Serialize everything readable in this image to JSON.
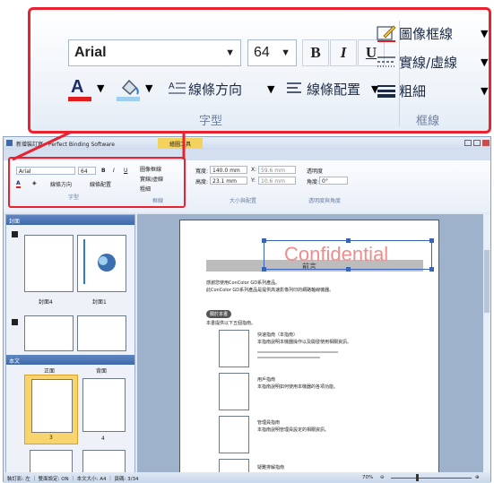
{
  "zoom": {
    "font_name": "Arial",
    "font_size": "64",
    "bold": "B",
    "italic": "I",
    "underline": "U",
    "line_direction": "線條方向",
    "line_layout": "線條配置",
    "group_font": "字型",
    "picture_border": "圖像框線",
    "solid_dashed": "實線/虛線",
    "thickness": "粗細",
    "group_border": "框線"
  },
  "titlebar": {
    "title": "新增裝訂寫 - Perfect Binding Software",
    "context_tab": "繪圖工具"
  },
  "ribbon": {
    "font_name": "Arial",
    "font_size": "64",
    "bold": "B",
    "italic": "I",
    "underline": "U",
    "line_direction": "線條方向",
    "line_layout": "線條配置",
    "group_font": "字型",
    "picture_border": "圖像框線",
    "solid_dashed": "實線/虛線",
    "thickness": "粗細",
    "group_border": "框線",
    "width_label": "寬度:",
    "width_value": "140.0 mm",
    "height_label": "高度:",
    "height_value": "23.1 mm",
    "x_label": "X:",
    "x_value": "59.6 mm",
    "y_label": "Y:",
    "y_value": "10.6 mm",
    "group_size": "大小與配置",
    "transparency_label": "透明度",
    "angle_label": "角度:",
    "angle_value": "0°",
    "group_transparency": "透明度與角度"
  },
  "left_pane": {
    "cover_title": "封面",
    "cover_left_label": "封面4",
    "cover_right_label": "封面1",
    "body_title": "本文",
    "col_front": "正面",
    "col_back": "背面",
    "page3_label": "3",
    "page4_label": "4"
  },
  "document": {
    "watermark": "Confidential",
    "heading": "前言",
    "intro_line1": "感謝您使用ConColor GD系列產品。",
    "intro_line2": "此ConColor GD系列產品是提供高速影像列印的網路軸線機器。",
    "section_badge": "關於本書",
    "section_text": "本書提供以下五個指南。",
    "items": [
      {
        "title": "快速指南（本指南）",
        "text": "本指南說明本機器操作以及開發使用相關資訊。"
      },
      {
        "title": "用戶指南",
        "text": "本指南說明如何使用本機器的各項功能。"
      },
      {
        "title": "管理員指南",
        "text": "本指南說明管理員設定的相關資訊。"
      },
      {
        "title": "疑難排解指南",
        "text": ""
      }
    ]
  },
  "status": {
    "text": "裝訂影: 左 ｜ 雙面設定: ON ｜ 本文大小: A4 ｜ 頁碼: 3/34",
    "zoom": "70%"
  }
}
